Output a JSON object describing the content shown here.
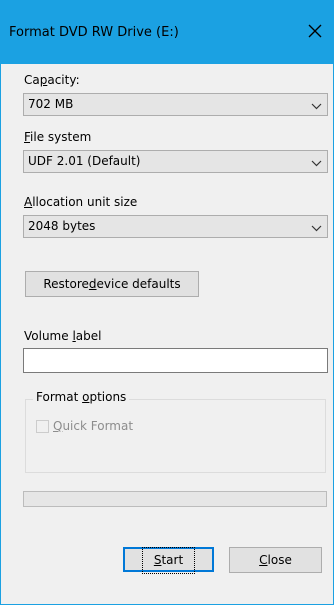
{
  "window": {
    "title": "Format DVD RW Drive (E:)",
    "accent_color": "#1ba1e2",
    "close_icon": "close-icon"
  },
  "capacity": {
    "label_pre": "Ca",
    "label_mn": "p",
    "label_post": "acity:",
    "value": "702 MB"
  },
  "file_system": {
    "label_mn": "F",
    "label_post": "ile system",
    "value": "UDF 2.01 (Default)"
  },
  "allocation": {
    "label_mn": "A",
    "label_post": "llocation unit size",
    "value": "2048 bytes"
  },
  "restore_button": {
    "label_pre": "Restore ",
    "label_mn": "d",
    "label_post": "evice defaults"
  },
  "volume_label": {
    "label_pre": "Volume ",
    "label_mn": "l",
    "label_post": "abel",
    "value": ""
  },
  "format_options": {
    "legend_pre": "Format ",
    "legend_mn": "o",
    "legend_post": "ptions",
    "quick_format": {
      "label_mn": "Q",
      "label_post": "uick Format",
      "checked": false,
      "enabled": false
    }
  },
  "progress": {
    "fraction": 0
  },
  "start_button": {
    "label_mn": "S",
    "label_post": "tart"
  },
  "close_button": {
    "label_mn": "C",
    "label_post": "lose"
  }
}
